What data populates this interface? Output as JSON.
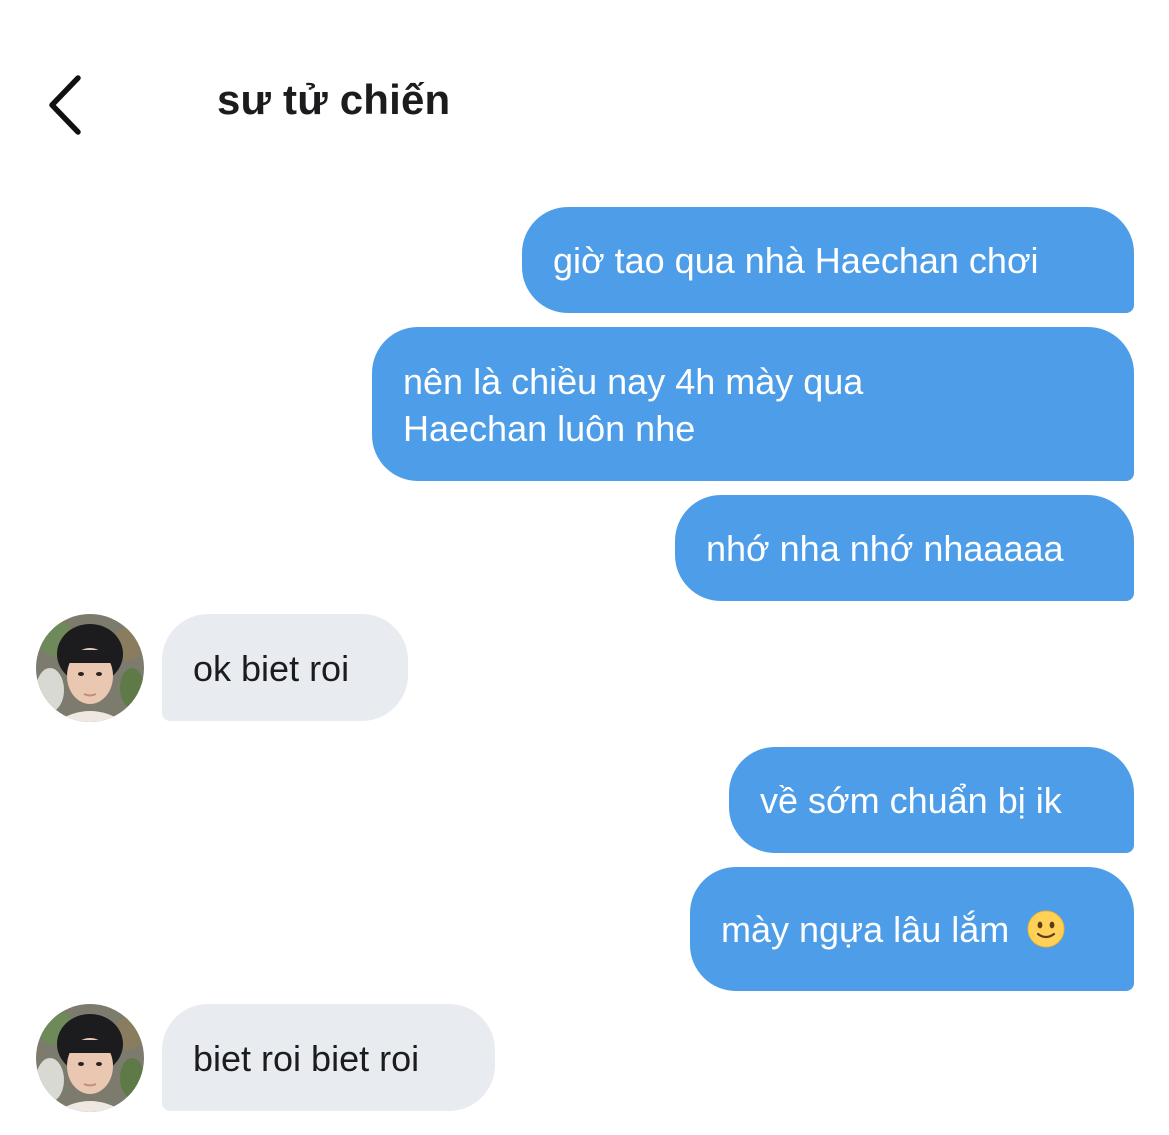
{
  "header": {
    "title": "sư tử chiến",
    "back_icon": "chevron-left-icon"
  },
  "colors": {
    "outgoing_bubble": "#4d9de8",
    "incoming_bubble": "#e8ecf0",
    "outgoing_text": "#ffffff",
    "incoming_text": "#1c1c1e"
  },
  "messages": [
    {
      "direction": "out",
      "lines": [
        "giờ tao qua nhà Haechan chơi"
      ]
    },
    {
      "direction": "out",
      "lines": [
        "nên là chiều nay 4h mày qua",
        "Haechan luôn nhe"
      ]
    },
    {
      "direction": "out",
      "lines": [
        "nhớ nha nhớ nhaaaaa"
      ]
    },
    {
      "direction": "in",
      "lines": [
        "ok biet roi"
      ],
      "avatar": "contact-avatar"
    },
    {
      "direction": "out",
      "lines": [
        "về sớm chuẩn bị ik"
      ]
    },
    {
      "direction": "out",
      "lines": [
        "mày ngựa lâu lắm"
      ],
      "emoji": "slightly-smiling-face-icon"
    },
    {
      "direction": "in",
      "lines": [
        "biet roi biet roi"
      ],
      "avatar": "contact-avatar"
    }
  ]
}
